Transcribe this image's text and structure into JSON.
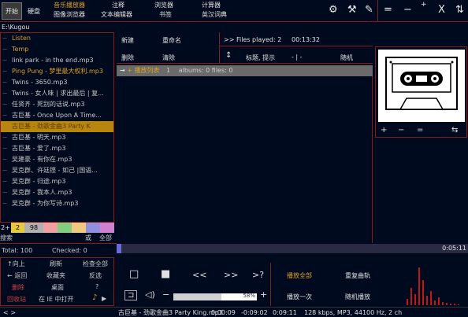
{
  "topbar": {
    "start_label": "开始",
    "disk_label": "硬盘",
    "menus": [
      {
        "line1": "音乐播放器",
        "line2": "图像浏览器"
      },
      {
        "line1": "注释",
        "line2": "文本编辑器"
      },
      {
        "line1": "浏览器",
        "line2": "书签"
      },
      {
        "line1": "计算器",
        "line2": "英汉词典"
      }
    ],
    "icons": [
      "gear-icon",
      "hammer-icon",
      "pencil-icon",
      "pin-icon"
    ],
    "window_controls": [
      "=",
      "−",
      "+",
      "X",
      "⇅"
    ]
  },
  "path": "E:\\Kugou",
  "playlist_left": {
    "items": [
      {
        "text": "Listen",
        "style": "folder"
      },
      {
        "text": "Temp",
        "style": "folder"
      },
      {
        "text": "link park - in the end.mp3",
        "style": "normal"
      },
      {
        "text": "Ping Pung - 梦里最大权利.mp3",
        "style": "hi"
      },
      {
        "text": "Twins - 3650.mp3",
        "style": "normal"
      },
      {
        "text": "Twins - 女人味 | 求出最后 | 复...",
        "style": "normal"
      },
      {
        "text": "任贤齐 - 死别的话说.mp3",
        "style": "normal"
      },
      {
        "text": "古巨基 - Once Upon A Time...",
        "style": "normal"
      },
      {
        "text": "古巨基 - 劲歌金曲3 Party K",
        "style": "sel"
      },
      {
        "text": "古巨基 - 明天.mp3",
        "style": "normal"
      },
      {
        "text": "古巨基 - 爱了.mp3",
        "style": "normal"
      },
      {
        "text": "吴建豪 - 有你在.mp3",
        "style": "normal"
      },
      {
        "text": "吴克群、许廷铿 - 如己 |国语...",
        "style": "normal"
      },
      {
        "text": "吴克群 - 归途.mp3",
        "style": "normal"
      },
      {
        "text": "吴克群 - 我本人.mp3",
        "style": "normal"
      },
      {
        "text": "吴克群 - 为你写诗.mp3",
        "style": "normal"
      }
    ]
  },
  "colorstrip": {
    "swatches": [
      {
        "label": "2+",
        "color": "#000a1e",
        "text": "#e0e0e0",
        "w": 14
      },
      {
        "label": "2",
        "color": "#e8c840",
        "text": "#000",
        "w": 17
      },
      {
        "label": "98",
        "color": "#b0b0b0",
        "text": "#000",
        "w": 24
      },
      {
        "label": "",
        "color": "#f0a0a0",
        "w": 18
      },
      {
        "label": "",
        "color": "#80d080",
        "w": 18
      },
      {
        "label": "",
        "color": "#f0c880",
        "w": 18
      },
      {
        "label": "",
        "color": "#9090e0",
        "w": 18
      },
      {
        "label": "",
        "color": "#d080d0",
        "w": 18
      }
    ]
  },
  "search": {
    "label": "搜索",
    "or": "或",
    "all": "全部"
  },
  "totals": {
    "total": "Total: 100",
    "checked": "Checked: 0"
  },
  "commands": {
    "up": "↑向上",
    "refresh": "刷新",
    "check_all": "检查全部",
    "back": "← 返回",
    "favorites": "收藏夹",
    "invert": "反选",
    "delete": "删除",
    "desktop": "桌面",
    "help": "?",
    "recycle": "回收站",
    "open_ie": "在 IE 中打开",
    "arrow_icon": "▶"
  },
  "midcmd": {
    "new": "新建",
    "rename": "重命名",
    "delete": "删除",
    "clear": "清除",
    "files_played_label": ">>  Files played: 2",
    "time": "00:13:32",
    "sort_icon": "↕",
    "title_hint": "标题, 提示",
    "sep": "- | -",
    "shuffle": "随机"
  },
  "plheader": {
    "prefix": "+ ",
    "name": "播放列表",
    "index": "1",
    "stats": "albums: 0   files: 0"
  },
  "cassette_controls": [
    "+",
    "−",
    "=",
    "⇆"
  ],
  "progress": {
    "time": "0:05:11",
    "value": 0.01
  },
  "transport": {
    "stop": "□",
    "pause": "■",
    "prev": "<<",
    "next": ">>",
    "question": ">?",
    "playlist_icon": "⊐",
    "speaker_icon": "🔈",
    "minus": "−",
    "plus": "+",
    "volume_label": "58%",
    "volume_value": 0.58
  },
  "playmode": {
    "play_all": "播放全部",
    "repeat": "重复曲轨",
    "play_once": "播放一次",
    "random": "随机播放"
  },
  "statusbar": {
    "arrows": "<  >",
    "now_playing": "古巨基 - 劲歌金曲3 Party King.mp3",
    "t1": "0:00:09",
    "t2": "-0:09:02",
    "t3": "0:09:11",
    "info": "128 kbps, MP3, 44100 Hz, 2 ch"
  },
  "spectrum": [
    8,
    22,
    14,
    48,
    32,
    12,
    18,
    6,
    10,
    4,
    3,
    2,
    2,
    1
  ]
}
